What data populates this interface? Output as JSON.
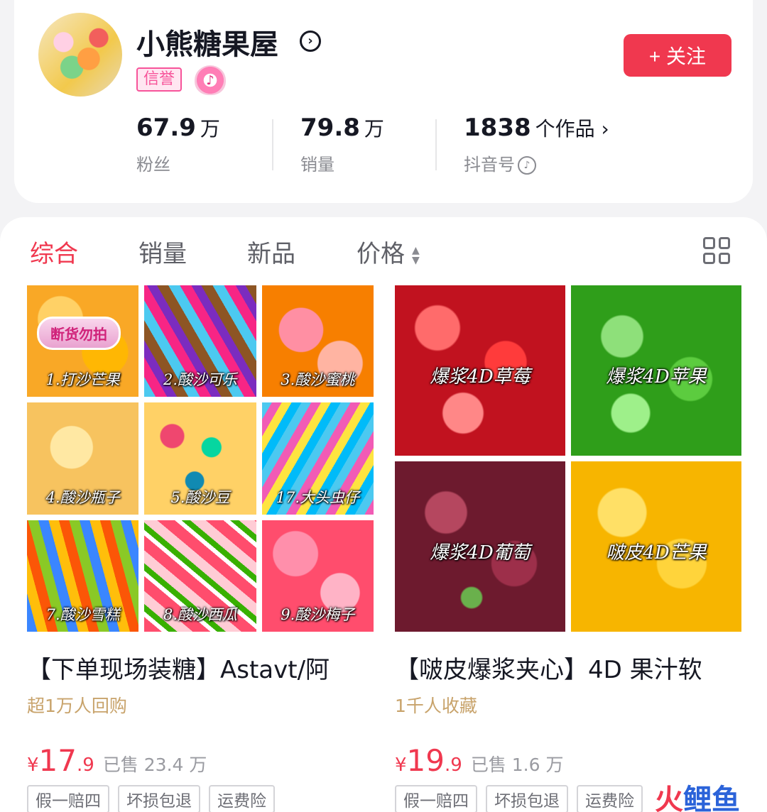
{
  "shop": {
    "name": "小熊糖果屋",
    "name_arrow_icon": "chevron-right-circle-icon",
    "credit_badge": "信誉",
    "level_badge_icon": "douyin-level-badge-icon",
    "follow_label": "+ 关注"
  },
  "stats": {
    "fans": {
      "value": "67.9",
      "unit": "万",
      "label": "粉丝"
    },
    "sales": {
      "value": "79.8",
      "unit": "万",
      "label": "销量"
    },
    "works": {
      "value": "1838",
      "unit": "个作品 ›",
      "label": "抖音号"
    }
  },
  "sort_tabs": {
    "comprehensive": "综合",
    "sales": "销量",
    "new": "新品",
    "price": "价格"
  },
  "products": [
    {
      "title": "【下单现场装糖】Astavt/阿",
      "subtitle": "超1万人回购",
      "price_currency": "¥",
      "price_int": "17",
      "price_dec": ".9",
      "sold": "已售 23.4 万",
      "tags": [
        "假一赔四",
        "坏损包退",
        "运费险"
      ],
      "stock_tag": "断货勿拍",
      "tiles": [
        "1.打沙芒果",
        "2.酸沙可乐",
        "3.酸沙蜜桃",
        "4.酸沙瓶子",
        "5.酸沙豆",
        "17.大头虫仔",
        "7.酸沙雪糕",
        "8.酸沙西瓜",
        "9.酸沙梅子"
      ]
    },
    {
      "title": "【啵皮爆浆夹心】4D 果汁软",
      "subtitle": "1千人收藏",
      "price_currency": "¥",
      "price_int": "19",
      "price_dec": ".9",
      "sold": "已售 1.6 万",
      "tags": [
        "假一赔四",
        "坏损包退",
        "运费险"
      ],
      "tiles": [
        "爆浆4D草莓",
        "爆浆4D苹果",
        "爆浆4D葡萄",
        "啵皮4D芒果"
      ]
    }
  ],
  "watermark": {
    "part1": "火",
    "part2": "鲤鱼"
  },
  "colors": {
    "accent": "#f0384f",
    "muted": "#8a8b91",
    "gold": "#c8a36b"
  }
}
